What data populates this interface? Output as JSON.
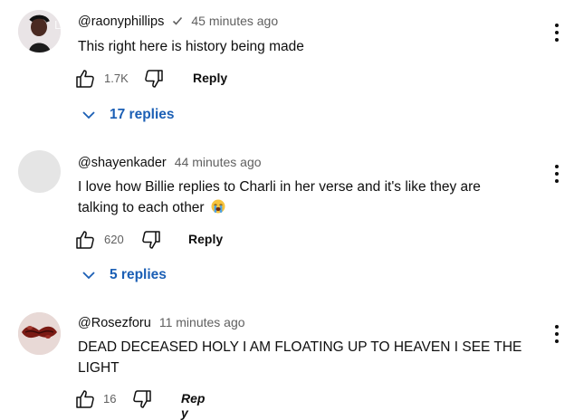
{
  "comments": [
    {
      "author": "@raonyphillips",
      "verified": true,
      "time": "45 minutes ago",
      "text": "This right here is history being made",
      "avatar_overlay": "Like",
      "likes": "1.7K",
      "reply_label": "Reply",
      "replies": "17 replies"
    },
    {
      "author": "@shayenkader",
      "verified": false,
      "time": "44 minutes ago",
      "text": "I love how Billie replies to Charli in her verse and it's like they are talking to each other",
      "emoji": "loudly-crying-face",
      "likes": "620",
      "reply_label": "Reply",
      "replies": "5 replies"
    },
    {
      "author": "@Rosezforu",
      "verified": false,
      "time": "11 minutes ago",
      "text": "DEAD DECEASED HOLY I AM FLOATING UP TO HEAVEN I SEE THE LIGHT",
      "likes": "16",
      "reply_label": "Rep y"
    }
  ],
  "icons": [
    "thumb-up-icon",
    "thumb-down-icon",
    "chevron-down-icon",
    "more-vert-icon",
    "verified-check-icon"
  ],
  "colors": {
    "text": "#0f0f0f",
    "secondary": "#606060",
    "link": "#1b5fb5"
  }
}
